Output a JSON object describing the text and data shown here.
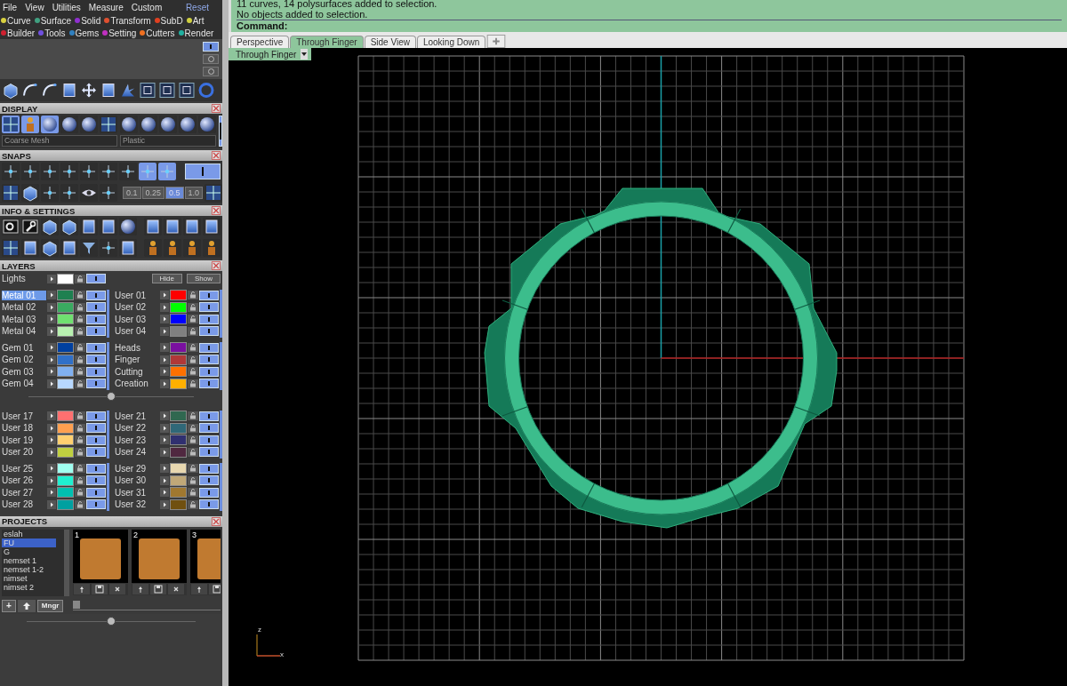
{
  "menu": [
    {
      "label": "File"
    },
    {
      "label": "View"
    },
    {
      "label": "Utilities"
    },
    {
      "label": "Measure"
    },
    {
      "label": "Custom"
    }
  ],
  "reset": "Reset",
  "categories": [
    [
      {
        "label": "Curve",
        "color": "#d8d040"
      },
      {
        "label": "Surface",
        "color": "#40a080"
      },
      {
        "label": "Solid",
        "color": "#9030d0"
      },
      {
        "label": "Transform",
        "color": "#e05030"
      },
      {
        "label": "SubD",
        "color": "#e04020"
      },
      {
        "label": "Art",
        "color": "#d0d040"
      }
    ],
    [
      {
        "label": "Builder",
        "color": "#d02030"
      },
      {
        "label": "Tools",
        "color": "#7050e0"
      },
      {
        "label": "Gems",
        "color": "#3080c0"
      },
      {
        "label": "Setting",
        "color": "#c030c0"
      },
      {
        "label": "Cutters",
        "color": "#f07020"
      },
      {
        "label": "Render",
        "color": "#20b0a0"
      }
    ]
  ],
  "display": {
    "title": "DISPLAY",
    "mesh": "Coarse Mesh",
    "material": "Plastic"
  },
  "snaps": {
    "title": "SNAPS",
    "steps": [
      {
        "label": "0.1",
        "selected": false
      },
      {
        "label": "0.25",
        "selected": false
      },
      {
        "label": "0.5",
        "selected": true
      },
      {
        "label": "1.0",
        "selected": false
      }
    ]
  },
  "info": {
    "title": "INFO & SETTINGS"
  },
  "layers": {
    "title": "LAYERS",
    "hide": "Hide",
    "show": "Show",
    "lights": {
      "name": "Lights",
      "color": "#ffffff",
      "on": true
    },
    "upper_blocks": [
      {
        "columns": [
          [
            {
              "name": "Metal 01",
              "color": "#1e8050",
              "selected": true,
              "on": true
            },
            {
              "name": "Metal 02",
              "color": "#3aaa60",
              "selected": false,
              "on": true
            },
            {
              "name": "Metal 03",
              "color": "#70e070",
              "selected": false,
              "on": true
            },
            {
              "name": "Metal 04",
              "color": "#b8f0b0",
              "selected": false,
              "on": true
            }
          ],
          [
            {
              "name": "User 01",
              "color": "#ff0000",
              "selected": false,
              "on": true
            },
            {
              "name": "User 02",
              "color": "#00ff00",
              "selected": false,
              "on": true
            },
            {
              "name": "User 03",
              "color": "#0000ff",
              "selected": false,
              "on": true
            },
            {
              "name": "User 04",
              "color": "#808080",
              "selected": false,
              "on": true
            }
          ]
        ]
      },
      {
        "columns": [
          [
            {
              "name": "Gem 01",
              "color": "#0040a0",
              "selected": false,
              "on": true
            },
            {
              "name": "Gem 02",
              "color": "#3070c8",
              "selected": false,
              "on": true
            },
            {
              "name": "Gem 03",
              "color": "#80b0f0",
              "selected": false,
              "on": true
            },
            {
              "name": "Gem 04",
              "color": "#b8d8ff",
              "selected": false,
              "on": true
            }
          ],
          [
            {
              "name": "Heads",
              "color": "#7a10a0",
              "selected": false,
              "on": true
            },
            {
              "name": "Finger",
              "color": "#b03838",
              "selected": false,
              "on": true
            },
            {
              "name": "Cutting",
              "color": "#ff7000",
              "selected": false,
              "on": true
            },
            {
              "name": "Creation",
              "color": "#ffb000",
              "selected": false,
              "on": true
            }
          ]
        ]
      }
    ],
    "lower_blocks": [
      {
        "columns": [
          [
            {
              "name": "User 17",
              "color": "#ff7070",
              "selected": false,
              "on": true
            },
            {
              "name": "User 18",
              "color": "#ffa050",
              "selected": false,
              "on": true
            },
            {
              "name": "User 19",
              "color": "#ffd070",
              "selected": false,
              "on": true
            },
            {
              "name": "User 20",
              "color": "#c0d040",
              "selected": false,
              "on": true
            }
          ],
          [
            {
              "name": "User 21",
              "color": "#306850",
              "selected": false,
              "on": true
            },
            {
              "name": "User 22",
              "color": "#306878",
              "selected": false,
              "on": true
            },
            {
              "name": "User 23",
              "color": "#303070",
              "selected": false,
              "on": true
            },
            {
              "name": "User 24",
              "color": "#502840",
              "selected": false,
              "on": true
            }
          ]
        ]
      },
      {
        "columns": [
          [
            {
              "name": "User 25",
              "color": "#a0fff0",
              "selected": false,
              "on": true
            },
            {
              "name": "User 26",
              "color": "#20f0d0",
              "selected": false,
              "on": true
            },
            {
              "name": "User 27",
              "color": "#00c0b0",
              "selected": false,
              "on": true
            },
            {
              "name": "User 28",
              "color": "#00a0a0",
              "selected": false,
              "on": true
            }
          ],
          [
            {
              "name": "User 29",
              "color": "#e8d8b0",
              "selected": false,
              "on": true
            },
            {
              "name": "User 30",
              "color": "#c0a878",
              "selected": false,
              "on": true
            },
            {
              "name": "User 31",
              "color": "#a07830",
              "selected": false,
              "on": true
            },
            {
              "name": "User 32",
              "color": "#705010",
              "selected": false,
              "on": true
            }
          ]
        ]
      }
    ]
  },
  "projects": {
    "title": "PROJECTS",
    "folders": [
      {
        "name": "eslah",
        "selected": false
      },
      {
        "name": "FU",
        "selected": true
      },
      {
        "name": "G",
        "selected": false
      },
      {
        "name": "nemset 1",
        "selected": false
      },
      {
        "name": "nemset 1-2",
        "selected": false
      },
      {
        "name": "nimset",
        "selected": false
      },
      {
        "name": "nimset 2",
        "selected": false
      }
    ],
    "thumbs": [
      {
        "number": "1"
      },
      {
        "number": "2"
      },
      {
        "number": "3"
      }
    ],
    "add": "+",
    "manager": "Mngr"
  },
  "command": {
    "lines": [
      "11 curves, 14 polysurfaces added to selection.",
      "No objects added to selection."
    ],
    "prompt": "Command:"
  },
  "viewport_tabs": [
    {
      "label": "Perspective",
      "selected": false
    },
    {
      "label": "Through Finger",
      "selected": true
    },
    {
      "label": "Side View",
      "selected": false
    },
    {
      "label": "Looking Down",
      "selected": false
    }
  ],
  "viewport": {
    "label": "Through Finger",
    "axes": {
      "z": "z",
      "x": "x"
    }
  }
}
